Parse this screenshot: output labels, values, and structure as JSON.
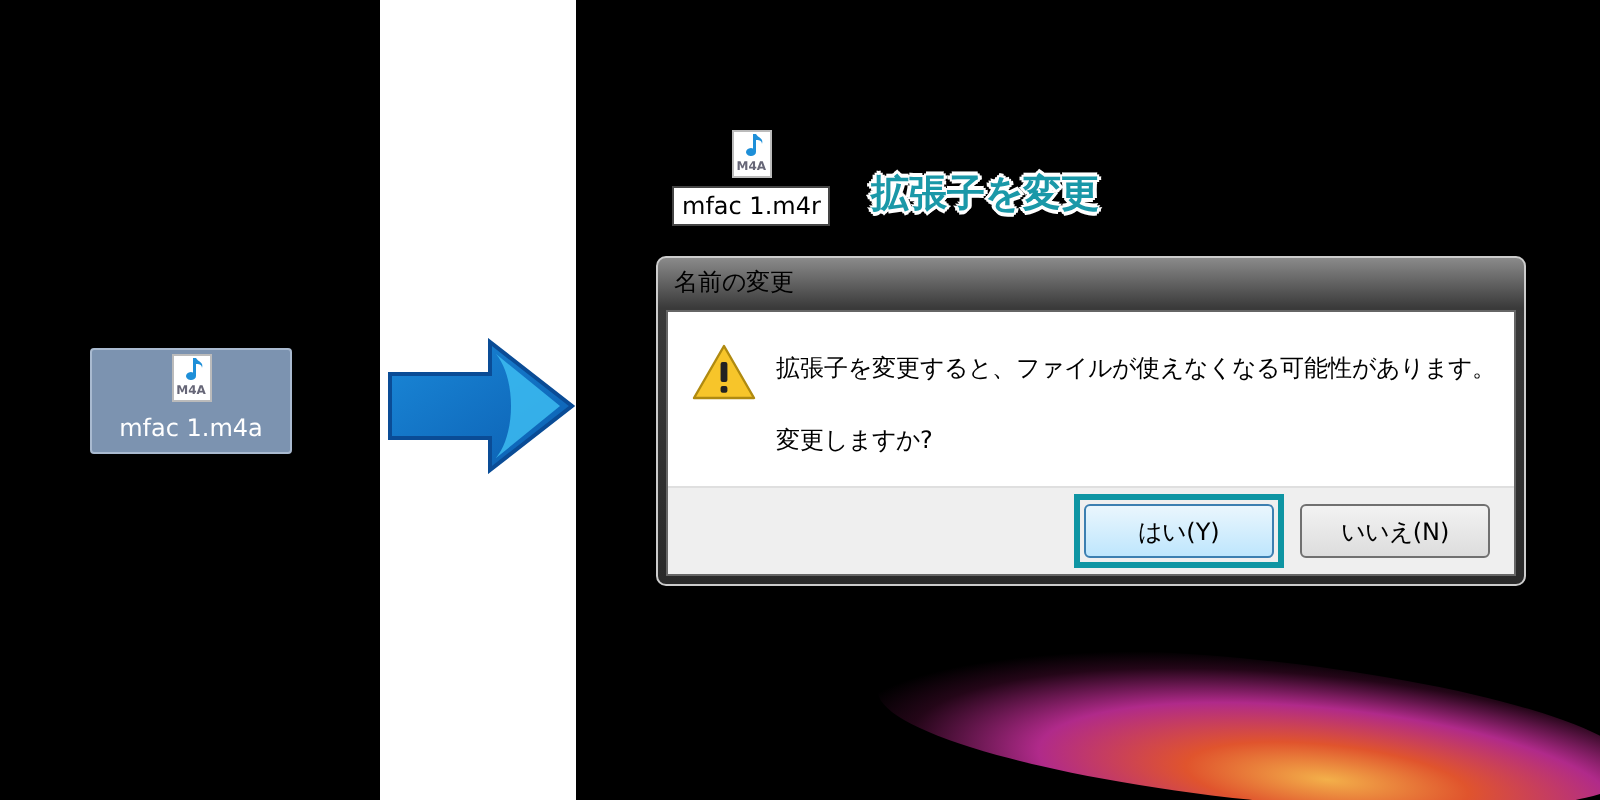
{
  "original_file": {
    "name": "mfac 1.m4a",
    "type_label": "M4A",
    "selected": true
  },
  "renamed_file": {
    "name": "mfac 1.m4r",
    "type_label": "M4A",
    "editing": true
  },
  "caption": "拡張子を変更",
  "dialog": {
    "title": "名前の変更",
    "message": "拡張子を変更すると、ファイルが使えなくなる可能性があります。",
    "question": "変更しますか?",
    "buttons": [
      {
        "label": "はい(Y)",
        "default": true,
        "highlighted": true
      },
      {
        "label": "いいえ(N)",
        "default": false,
        "highlighted": false
      }
    ]
  }
}
